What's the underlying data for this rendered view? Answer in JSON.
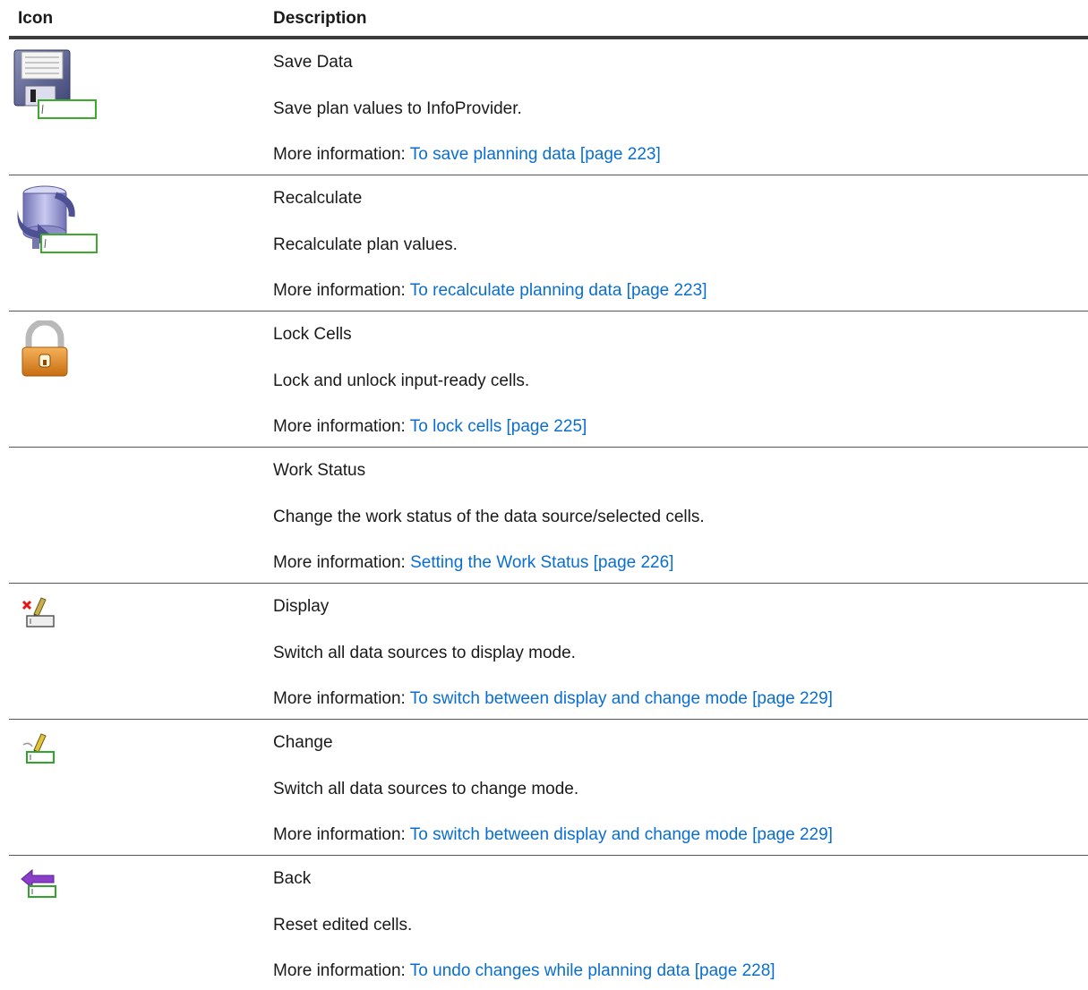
{
  "header": {
    "col_icon": "Icon",
    "col_description": "Description"
  },
  "rows": [
    {
      "icon": "save-data-icon",
      "title": "Save Data",
      "description": "Save plan values to InfoProvider.",
      "more_label": "More information: ",
      "link": "To save planning data [page 223]"
    },
    {
      "icon": "recalculate-icon",
      "title": "Recalculate",
      "description": "Recalculate plan values.",
      "more_label": "More information: ",
      "link": "To recalculate planning data [page 223]"
    },
    {
      "icon": "lock-icon",
      "title": "Lock Cells",
      "description": "Lock and unlock input-ready cells.",
      "more_label": "More information: ",
      "link": "To lock cells [page 225]"
    },
    {
      "icon": "",
      "title": "Work Status",
      "description": "Change the work status of the data source/selected cells.",
      "more_label": "More information: ",
      "link": "Setting the Work Status [page 226]"
    },
    {
      "icon": "display-mode-icon",
      "title": "Display",
      "description": "Switch all data sources to display mode.",
      "more_label": "More information: ",
      "link": "To switch between display and change mode [page 229]"
    },
    {
      "icon": "change-mode-icon",
      "title": "Change",
      "description": "Switch all data sources to change mode.",
      "more_label": "More information: ",
      "link": "To switch between display and change mode [page 229]"
    },
    {
      "icon": "back-arrow-icon",
      "title": "Back",
      "description": "Reset edited cells.",
      "more_label": "More information: ",
      "link": "To undo changes while planning data [page 228]"
    }
  ],
  "colors": {
    "link": "#0a6ed1",
    "rule": "#3c3c3c"
  }
}
